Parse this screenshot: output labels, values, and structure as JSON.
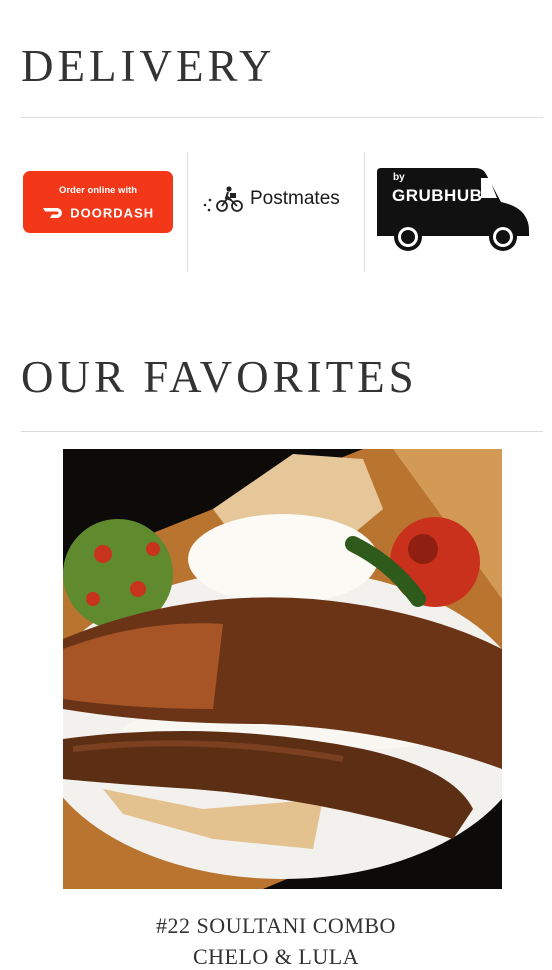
{
  "delivery": {
    "title": "DELIVERY",
    "doordash": {
      "pre_label": "Order online with",
      "brand": "DOORDASH",
      "color": "#f3381a"
    },
    "postmates": {
      "brand": "Postmates"
    },
    "grubhub": {
      "by": "by",
      "brand": "GRUBHUB",
      "trademark": "™"
    }
  },
  "favorites": {
    "title": "OUR FAVORITES",
    "items": [
      {
        "name": "#22 SOULTANI COMBO",
        "subtitle": "CHELO & LULA"
      }
    ]
  }
}
